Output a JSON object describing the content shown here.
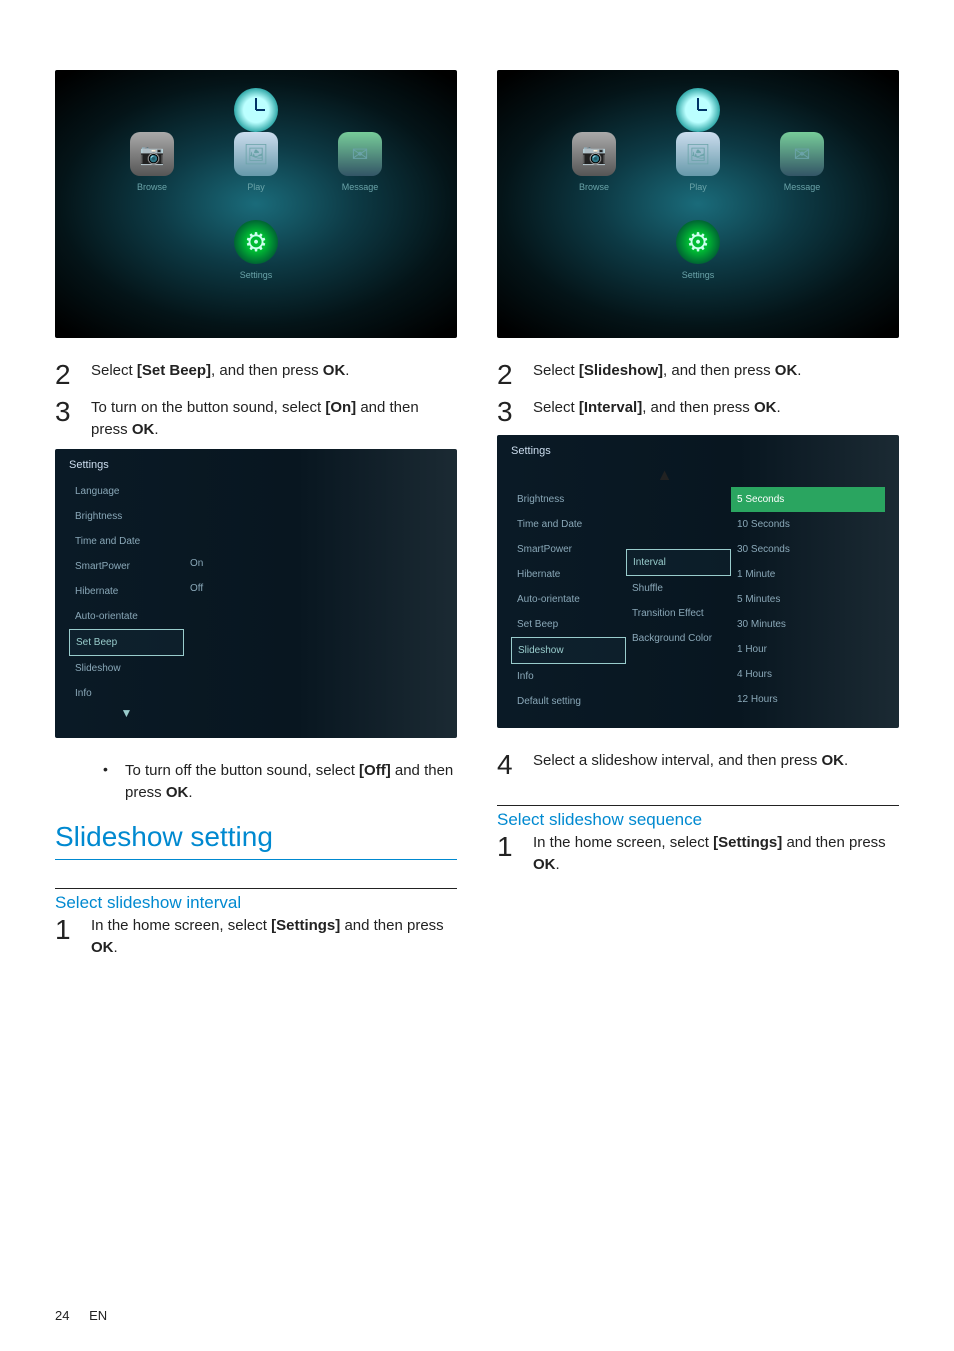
{
  "page": {
    "number": "24",
    "lang": "EN"
  },
  "home": {
    "clock_label": "Clock",
    "browse": "Browse",
    "play": "Play",
    "message": "Message",
    "settings": "Settings"
  },
  "left": {
    "step2": {
      "pre": "Select ",
      "bold1": "[Set Beep]",
      "mid": ", and then press ",
      "bold2": "OK",
      "post": "."
    },
    "step3": {
      "pre": "To turn on the button sound, select ",
      "bold1": "[On]",
      "mid": " and then press ",
      "bold2": "OK",
      "post": "."
    },
    "bullet": {
      "pre": "To turn off the button sound, select ",
      "bold1": "[Off]",
      "mid": " and then press ",
      "bold2": "OK",
      "post": "."
    },
    "section_title": "Slideshow setting",
    "sub_title": "Select slideshow interval",
    "seq_step1": {
      "pre": "In the home screen, select ",
      "bold1": "[Settings]",
      "mid": " and then press ",
      "bold2": "OK",
      "post": "."
    }
  },
  "right": {
    "step2": {
      "pre": "Select ",
      "bold1": "[Slideshow]",
      "mid": ", and then press ",
      "bold2": "OK",
      "post": "."
    },
    "step3": {
      "pre": "Select ",
      "bold1": "[Interval]",
      "mid": ", and then press ",
      "bold2": "OK",
      "post": "."
    },
    "step4": {
      "pre": "Select a slideshow interval, and then press ",
      "bold1": "OK",
      "post": "."
    },
    "sub_title": "Select slideshow sequence",
    "seq_step1": {
      "pre": "In the home screen, select ",
      "bold1": "[Settings]",
      "mid": " and then press ",
      "bold2": "OK",
      "post": "."
    }
  },
  "settings1": {
    "title": "Settings",
    "left_items": [
      "Language",
      "Brightness",
      "Time and Date",
      "SmartPower",
      "Hibernate",
      "Auto-orientate",
      "Set Beep",
      "Slideshow",
      "Info"
    ],
    "selected_left_index": 6,
    "mid_items": [
      "On",
      "Off"
    ]
  },
  "settings2": {
    "title": "Settings",
    "left_items": [
      "Brightness",
      "Time and Date",
      "SmartPower",
      "Hibernate",
      "Auto-orientate",
      "Set Beep",
      "Slideshow",
      "Info",
      "Default setting"
    ],
    "selected_left_index": 6,
    "mid_items": [
      "Interval",
      "Shuffle",
      "Transition Effect",
      "Background Color"
    ],
    "selected_mid_index": 0,
    "right_items": [
      "5 Seconds",
      "10 Seconds",
      "30 Seconds",
      "1 Minute",
      "5 Minutes",
      "30 Minutes",
      "1 Hour",
      "4 Hours",
      "12 Hours"
    ],
    "highlight_right_index": 0
  }
}
